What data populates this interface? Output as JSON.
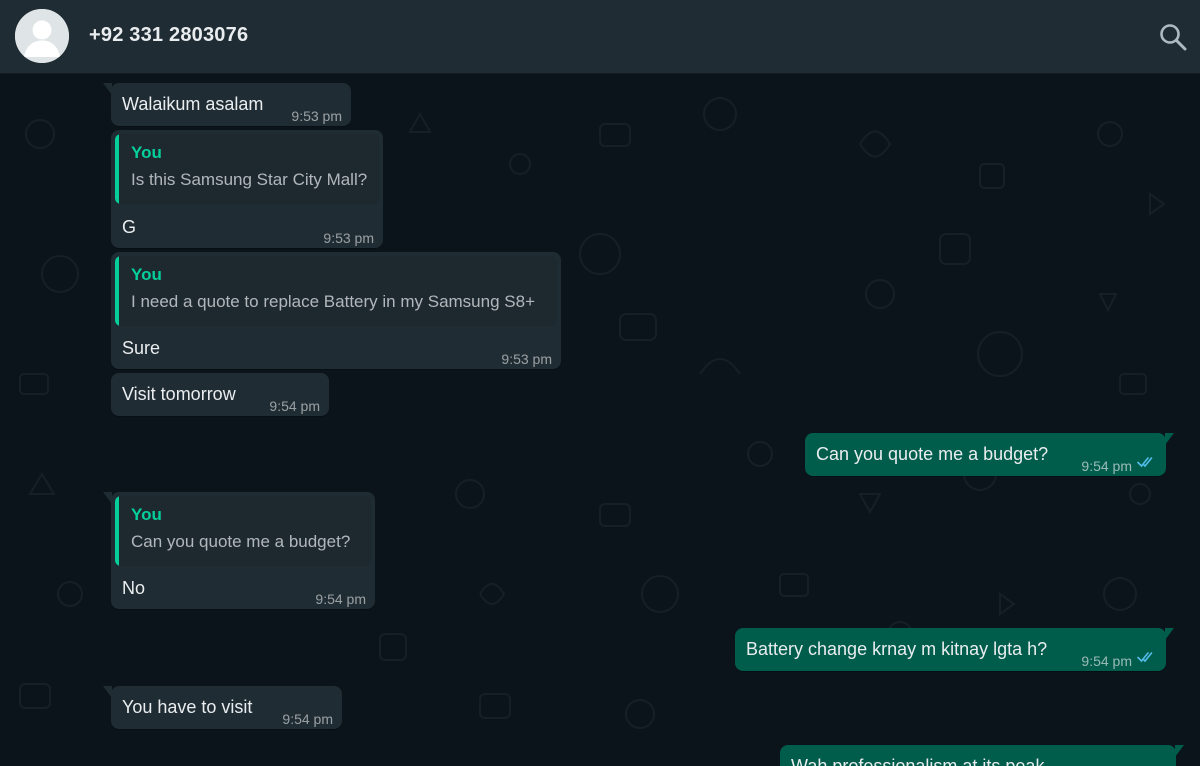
{
  "header": {
    "contact_name": "+92 331 2803076",
    "avatar_icon": "default-avatar-icon",
    "search_icon": "search-icon"
  },
  "colors": {
    "header_bg": "#202c33",
    "chat_bg": "#0b141a",
    "incoming_bubble": "#202c33",
    "outgoing_bubble": "#005c4b",
    "quote_accent": "#06cf9c",
    "read_ticks": "#53bdeb"
  },
  "messages": [
    {
      "direction": "in",
      "text": "Walaikum asalam",
      "time": "9:53 pm"
    },
    {
      "direction": "in",
      "quote_author": "You",
      "quote_text": "Is this Samsung Star City Mall?",
      "text": "G",
      "time": "9:53 pm"
    },
    {
      "direction": "in",
      "quote_author": "You",
      "quote_text": "I need a quote to replace Battery in my Samsung S8+",
      "text": "Sure",
      "time": "9:53 pm"
    },
    {
      "direction": "in",
      "text": "Visit tomorrow",
      "time": "9:54 pm"
    },
    {
      "direction": "out",
      "text": "Can you quote me a budget?",
      "time": "9:54 pm",
      "status": "read"
    },
    {
      "direction": "in",
      "quote_author": "You",
      "quote_text": "Can you quote me a budget?",
      "text": "No",
      "time": "9:54 pm"
    },
    {
      "direction": "out",
      "text": "Battery change krnay m kitnay lgta h?",
      "time": "9:54 pm",
      "status": "read"
    },
    {
      "direction": "in",
      "text": "You have to visit",
      "time": "9:54 pm"
    },
    {
      "direction": "out",
      "text": "Wah professionalism at its peak",
      "time": "",
      "status": ""
    }
  ]
}
